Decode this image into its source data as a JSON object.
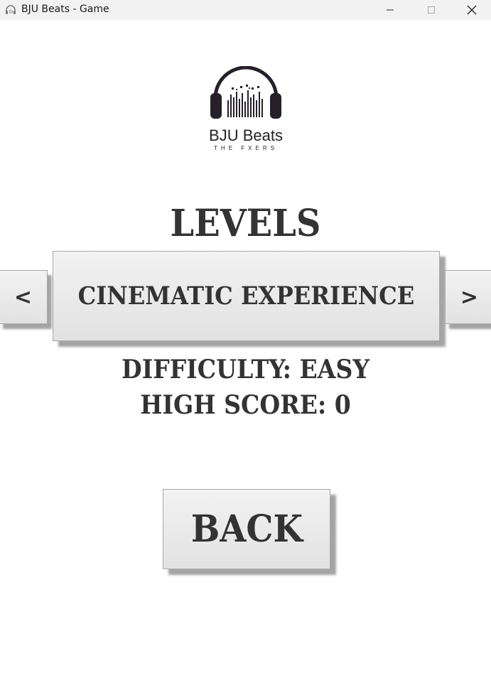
{
  "window": {
    "title": "BJU Beats - Game",
    "icon": "headphones-icon"
  },
  "logo": {
    "title": "BJU Beats",
    "subtitle": "THE FXERS"
  },
  "levels": {
    "heading": "LEVELS",
    "current_level": "CINEMATIC EXPERIENCE",
    "prev_label": "<",
    "next_label": ">",
    "difficulty": "DIFFICULTY: EASY",
    "high_score": "HIGH SCORE: 0"
  },
  "actions": {
    "back_label": "BACK"
  },
  "colors": {
    "text": "#333333",
    "button_bg": "#e8e8e8",
    "titlebar_bg": "#f2f2f2",
    "logo": "#25202a"
  }
}
